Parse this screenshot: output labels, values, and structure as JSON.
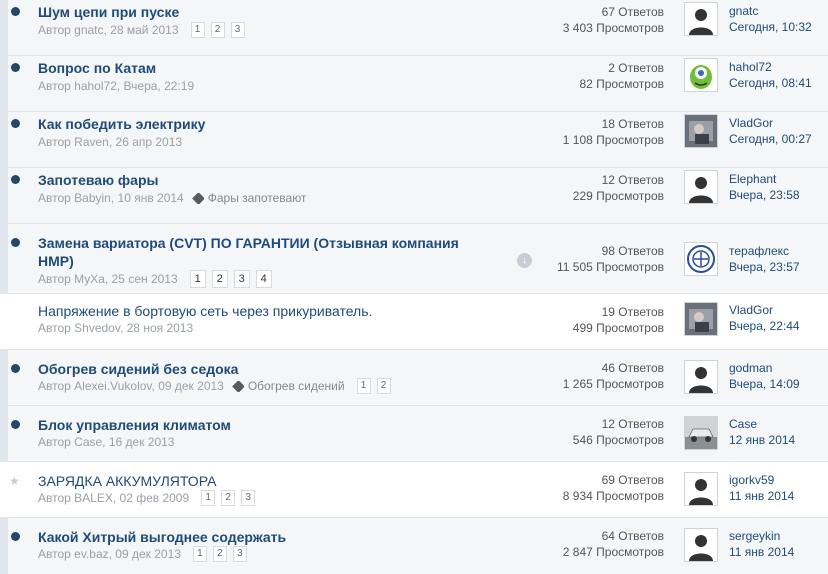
{
  "topics": [
    {
      "title": "Шум цепи при пуске",
      "author_line": "Автор gnatc, 28 май 2013",
      "pages": [
        "1",
        "2",
        "3"
      ],
      "replies": "67 Ответов",
      "views": "3 403 Просмотров",
      "last_user": "gnatc",
      "last_time": "Сегодня, 10:32",
      "avatar": "default-avatar"
    },
    {
      "title": "Вопрос по Катам",
      "author_line": "Автор hahol72, Вчера, 22:19",
      "replies": "2 Ответов",
      "views": "82 Просмотров",
      "last_user": "hahol72",
      "last_time": "Сегодня, 08:41",
      "avatar": "alien-avatar"
    },
    {
      "title": "Как победить электрику",
      "author_line": "Автор Raven, 26 апр 2013",
      "replies": "18 Ответов",
      "views": "1 108 Просмотров",
      "last_user": "VladGor",
      "last_time": "Сегодня, 00:27",
      "avatar": "photo-avatar"
    },
    {
      "title": "Запотеваю фары",
      "author_line": "Автор Babyin, 10 янв 2014",
      "tag": "Фары запотевают",
      "replies": "12 Ответов",
      "views": "229 Просмотров",
      "last_user": "Elephant",
      "last_time": "Вчера, 23:58",
      "avatar": "default-avatar"
    },
    {
      "title": "Замена вариатора (CVT) ПО ГАРАНТИИ (Отзывная компания НМР)",
      "author_line": "Автор МуХа, 25 сен 2013",
      "pages": [
        "1",
        "2",
        "3",
        "4"
      ],
      "replies": "98 Ответов",
      "views": "11 505 Просмотров",
      "last_user": "терафлекс",
      "last_time": "Вчера, 23:57",
      "avatar": "seal-avatar"
    },
    {
      "title": "Напряжение в бортовую сеть через прикуриватель.",
      "author_line": "Автор Shvedov, 28 ноя 2013",
      "replies": "19 Ответов",
      "views": "499 Просмотров",
      "last_user": "VladGor",
      "last_time": "Вчера, 22:44",
      "avatar": "photo-avatar"
    },
    {
      "title": "Обогрев сидений без седока",
      "author_line": "Автор Alexei.Vukolov, 09 дек 2013",
      "tag": "Обогрев сидений",
      "pages": [
        "1",
        "2"
      ],
      "replies": "46 Ответов",
      "views": "1 265 Просмотров",
      "last_user": "godman",
      "last_time": "Вчера, 14:09",
      "avatar": "default-avatar"
    },
    {
      "title": "Блок управления климатом",
      "author_line": "Автор Case, 16 дек 2013",
      "replies": "12 Ответов",
      "views": "546 Просмотров",
      "last_user": "Case",
      "last_time": "12 янв 2014",
      "avatar": "car-avatar"
    },
    {
      "title": "ЗАРЯДКА АККУМУЛЯТОРА",
      "author_line": "Автор BALEX, 02 фев 2009",
      "pages": [
        "1",
        "2",
        "3"
      ],
      "replies": "69 Ответов",
      "views": "8 934 Просмотров",
      "last_user": "igorkv59",
      "last_time": "11 янв 2014",
      "avatar": "default-avatar"
    },
    {
      "title": "Какой Хитрый выгоднее содержать",
      "author_line": "Автор ev.baz, 09 дек 2013",
      "pages": [
        "1",
        "2",
        "3"
      ],
      "replies": "64 Ответов",
      "views": "2 847 Просмотров",
      "last_user": "sergeykin",
      "last_time": "11 янв 2014",
      "avatar": "default-avatar"
    }
  ]
}
